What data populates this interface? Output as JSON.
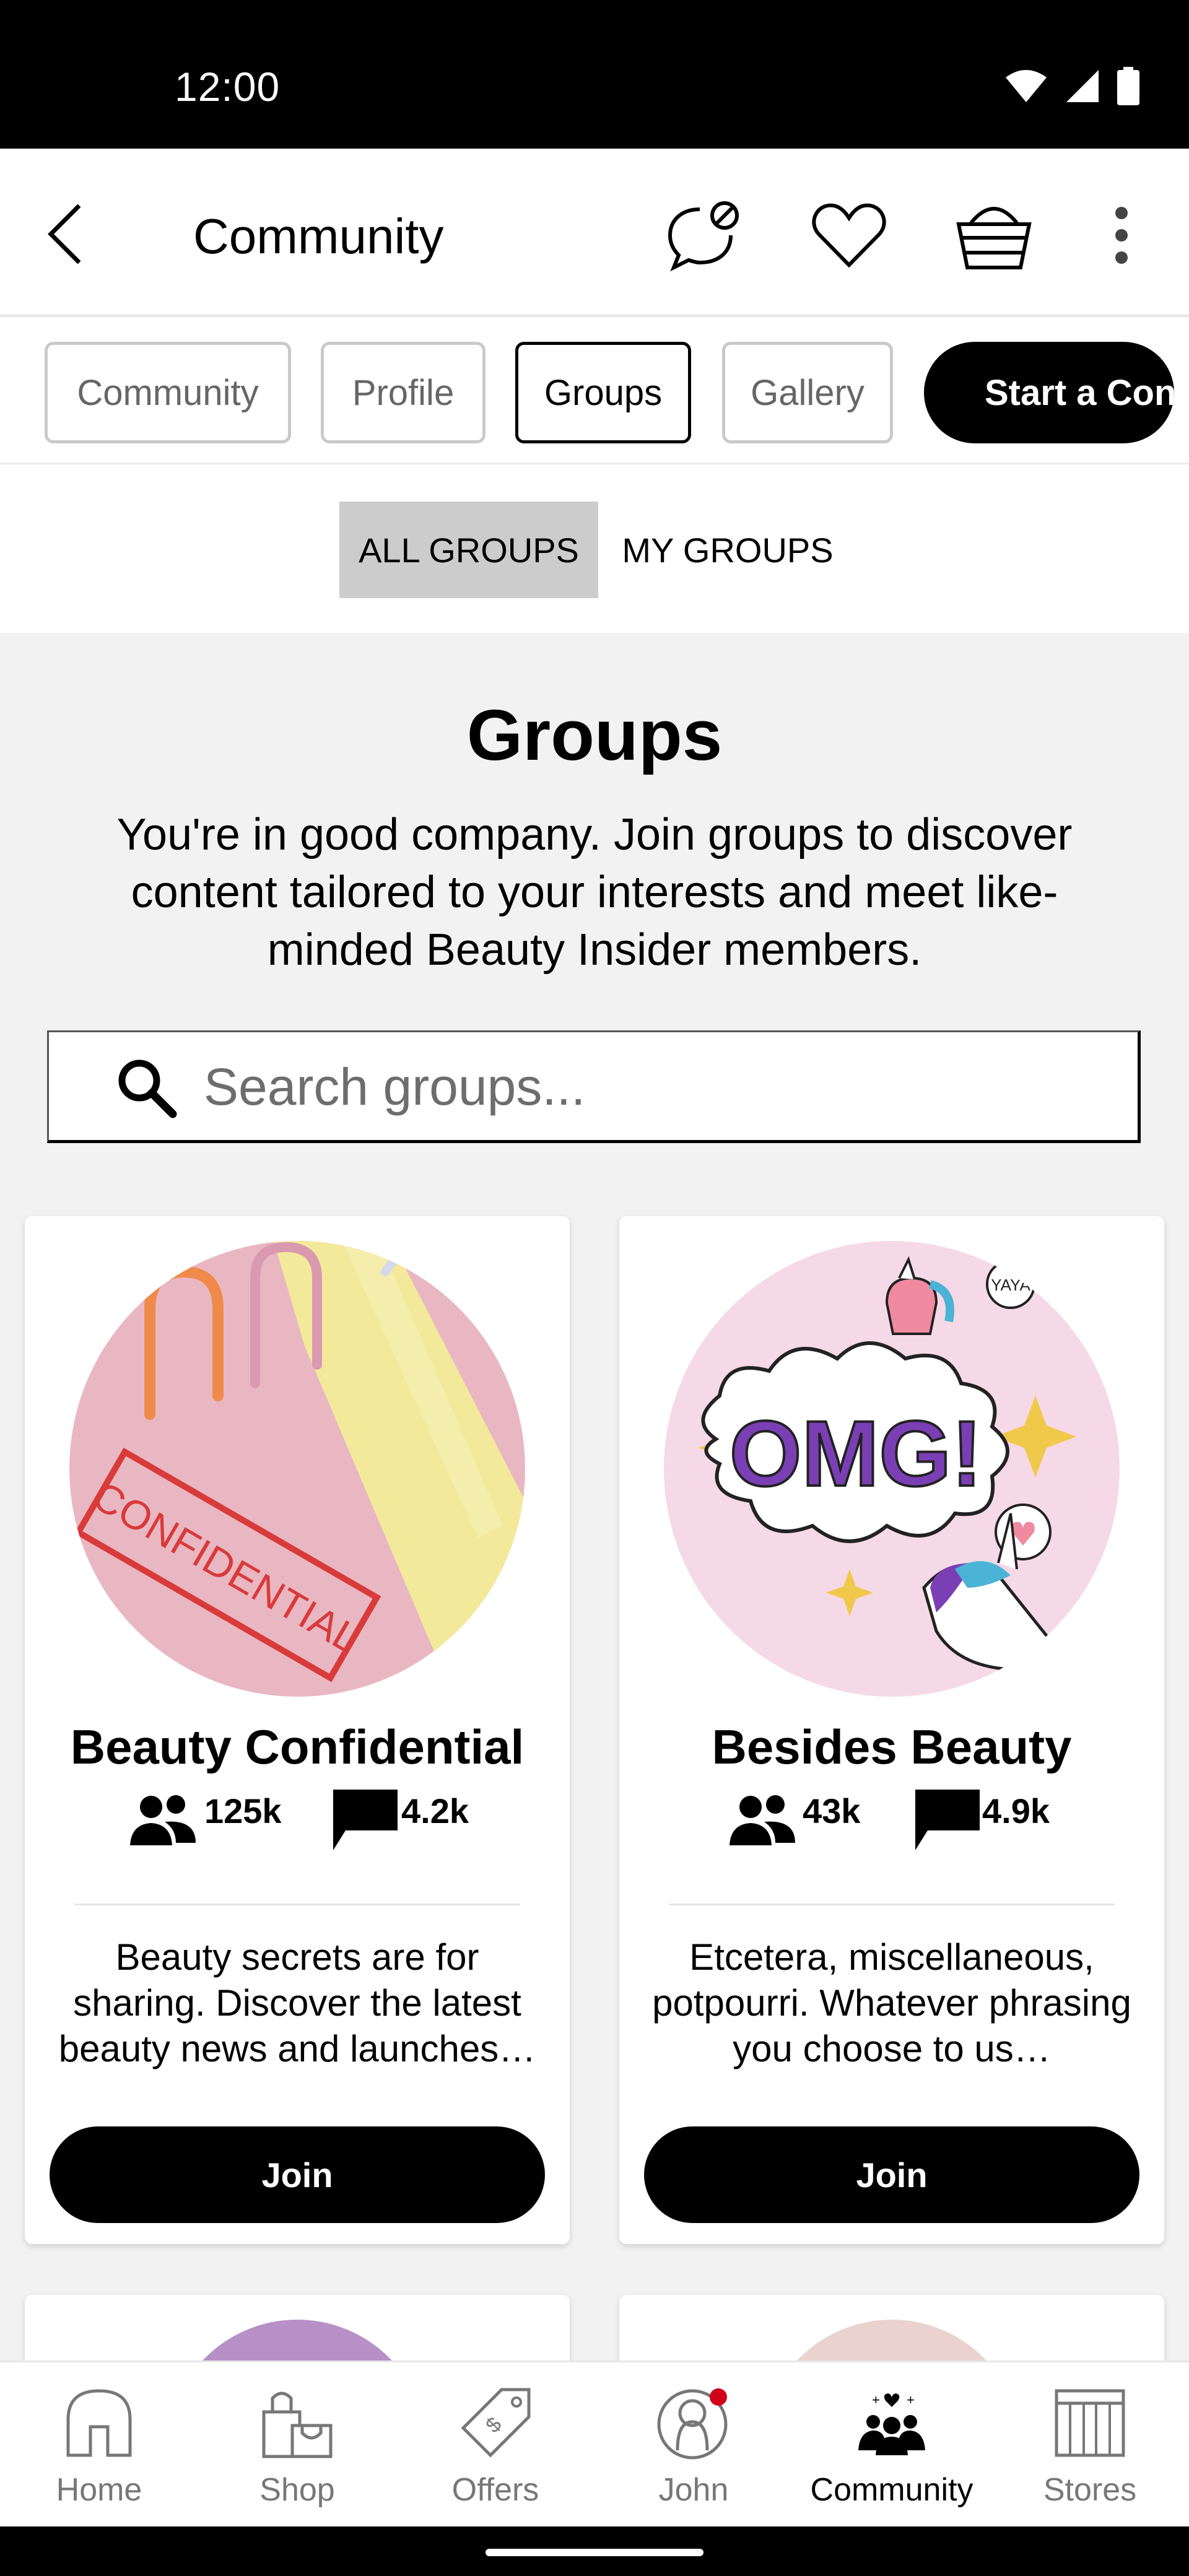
{
  "status_bar": {
    "time": "12:00"
  },
  "app_bar": {
    "title": "Community"
  },
  "tabs": [
    {
      "label": "Community",
      "active": false
    },
    {
      "label": "Profile",
      "active": false
    },
    {
      "label": "Groups",
      "active": true
    },
    {
      "label": "Gallery",
      "active": false
    },
    {
      "label": "Start a Conv",
      "cta": true
    }
  ],
  "segment": {
    "all_label": "ALL GROUPS",
    "mine_label": "MY GROUPS",
    "selected": "ALL GROUPS"
  },
  "groups": {
    "title": "Groups",
    "description": "You're in good company. Join groups to discover content tailored to your interests and meet like-minded Beauty Insider members."
  },
  "search": {
    "placeholder": "Search groups..."
  },
  "cards": [
    {
      "name": "Beauty Confidential",
      "members": "125k",
      "posts": "4.2k",
      "description": "Beauty secrets are for sharing. Discover the latest beauty news and launches…",
      "join_label": "Join",
      "image_text": "CONFIDENTIAL"
    },
    {
      "name": "Besides Beauty",
      "members": "43k",
      "posts": "4.9k",
      "description": "Etcetera, miscellaneous, potpourri. Whatever phrasing you choose to us…",
      "join_label": "Join",
      "image_text": "OMG!",
      "image_bubble_text": "YAYA"
    }
  ],
  "bottom_nav": [
    {
      "label": "Home",
      "icon": "home-icon"
    },
    {
      "label": "Shop",
      "icon": "shop-bag-icon"
    },
    {
      "label": "Offers",
      "icon": "offers-tag-icon"
    },
    {
      "label": "John",
      "icon": "profile-icon"
    },
    {
      "label": "Community",
      "icon": "community-icon",
      "active": true
    },
    {
      "label": "Stores",
      "icon": "store-icon"
    }
  ],
  "colors": {
    "accent": "#000000",
    "notification_dot": "#d0021b",
    "background": "#f2f2f2"
  }
}
